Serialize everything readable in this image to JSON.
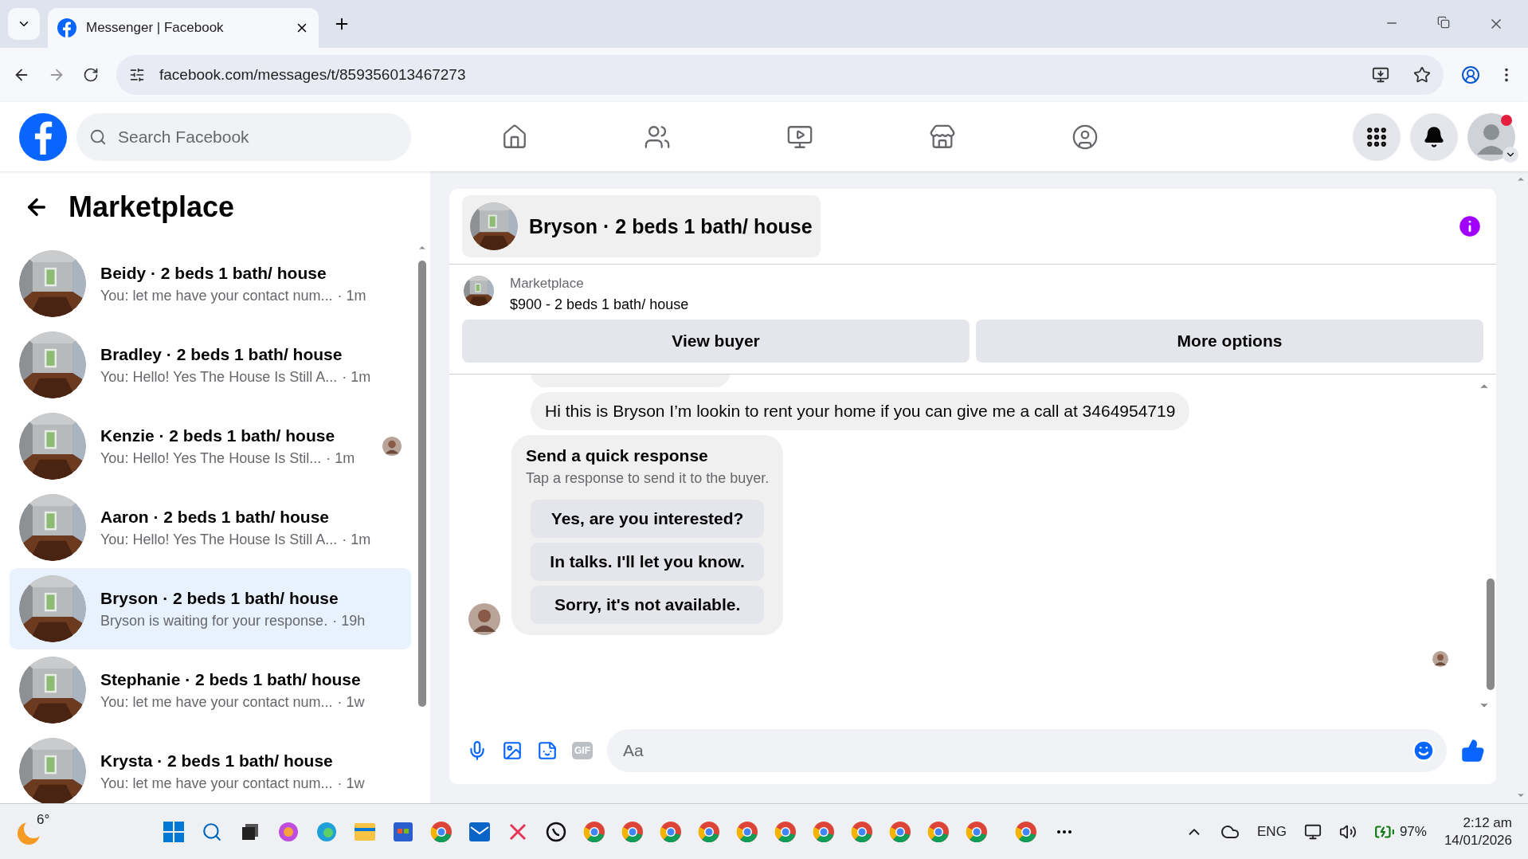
{
  "browser": {
    "tab_title": "Messenger | Facebook",
    "url": "facebook.com/messages/t/859356013467273"
  },
  "facebook": {
    "search_placeholder": "Search Facebook",
    "nav": [
      {
        "kind": "home",
        "selected": false
      },
      {
        "kind": "friends",
        "selected": false
      },
      {
        "kind": "video",
        "selected": false
      },
      {
        "kind": "marketplace",
        "selected": false
      },
      {
        "kind": "groups",
        "selected": false
      }
    ],
    "notification_dot": true
  },
  "sidebar": {
    "title": "Marketplace",
    "conversations": [
      {
        "name": "Beidy · 2 beds 1 bath/ house",
        "preview": "You: let me have your contact num...",
        "time": "· 1m",
        "selected": false,
        "seen": false
      },
      {
        "name": "Bradley · 2 beds 1 bath/ house",
        "preview": "You: Hello! Yes The House Is Still A...",
        "time": "· 1m",
        "selected": false,
        "seen": false
      },
      {
        "name": "Kenzie · 2 beds 1 bath/ house",
        "preview": "You: Hello! Yes The House Is Stil...",
        "time": "· 1m",
        "selected": false,
        "seen": true
      },
      {
        "name": "Aaron · 2 beds 1 bath/ house",
        "preview": "You: Hello! Yes The House Is Still A...",
        "time": "· 1m",
        "selected": false,
        "seen": false
      },
      {
        "name": "Bryson · 2 beds 1 bath/ house",
        "preview": "Bryson is waiting for your response.",
        "time": "· 19h",
        "selected": true,
        "seen": false
      },
      {
        "name": "Stephanie · 2 beds 1 bath/ house",
        "preview": "You: let me have your contact num...",
        "time": "· 1w",
        "selected": false,
        "seen": false
      },
      {
        "name": "Krysta · 2 beds 1 bath/ house",
        "preview": "You: let me have your contact num...",
        "time": "· 1w",
        "selected": false,
        "seen": false
      }
    ]
  },
  "chat": {
    "title": "Bryson · 2 beds 1 bath/ house",
    "listing_label": "Marketplace",
    "listing": "$900 - 2 beds 1 bath/ house",
    "buttons": [
      "View buyer",
      "More options"
    ],
    "message": "Hi this is Bryson I’m lookin to rent your home if you can give me a call at 3464954719",
    "quick_response": {
      "title": "Send a quick response",
      "subtitle": "Tap a response to send it to the buyer.",
      "options": [
        "Yes, are you interested?",
        "In talks. I'll let you know.",
        "Sorry, it's not available."
      ]
    },
    "gif_label": "GIF",
    "composer_placeholder": "Aa"
  },
  "taskbar": {
    "weather": "6°",
    "language": "ENG",
    "battery": "97%",
    "time": "2:12 am",
    "date": "14/01/2026"
  }
}
